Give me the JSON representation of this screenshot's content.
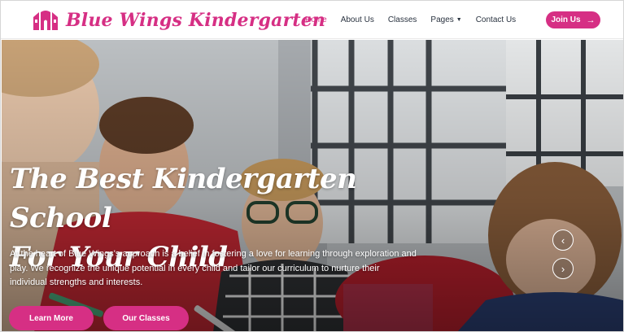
{
  "brand": {
    "name": "Blue Wings Kindergarten",
    "accent_color": "#d62f84",
    "icon": "building-logo-icon"
  },
  "nav": {
    "items": [
      {
        "label": "Home",
        "active": true
      },
      {
        "label": "About Us",
        "active": false
      },
      {
        "label": "Classes",
        "active": false
      },
      {
        "label": "Pages",
        "active": false,
        "has_dropdown": true
      },
      {
        "label": "Contact Us",
        "active": false
      }
    ],
    "join_button": "Join Us",
    "join_icon": "arrow-right-icon"
  },
  "hero": {
    "title_line1": "The Best Kindergarten School",
    "title_line2": "For Your Child",
    "description": "At the heart of Blue Wings's approach is a belief in fostering a love for learning through exploration and play. We recognize the unique potential in every child and tailor our curriculum to nurture their individual strengths and interests.",
    "primary_button": "Learn More",
    "secondary_button": "Our Classes",
    "prev_icon": "chevron-left-icon",
    "next_icon": "chevron-right-icon"
  }
}
